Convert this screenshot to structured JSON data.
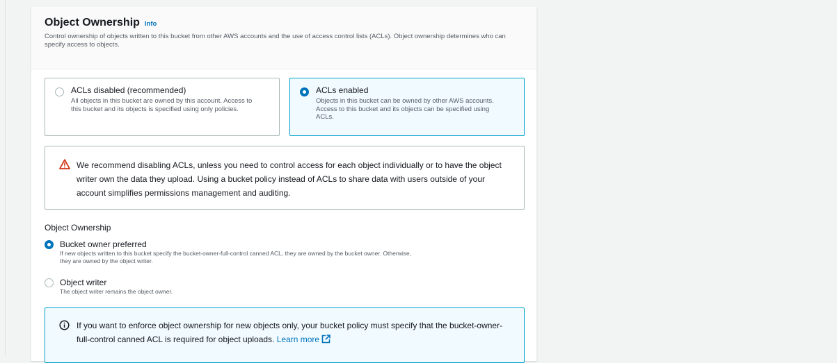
{
  "section": {
    "title": "Object Ownership",
    "info_label": "Info",
    "description": "Control ownership of objects written to this bucket from other AWS accounts and the use of access control lists (ACLs). Object ownership determines who can specify access to objects."
  },
  "acl_tiles": [
    {
      "label": "ACLs disabled (recommended)",
      "description": "All objects in this bucket are owned by this account. Access to this bucket and its objects is specified using only policies.",
      "selected": false
    },
    {
      "label": "ACLs enabled",
      "description": "Objects in this bucket can be owned by other AWS accounts. Access to this bucket and its objects can be specified using ACLs.",
      "selected": true
    }
  ],
  "warning": {
    "icon": "warning-triangle-icon",
    "text": "We recommend disabling ACLs, unless you need to control access for each object individually or to have the object writer own the data they upload. Using a bucket policy instead of ACLs to share data with users outside of your account simplifies permissions management and auditing."
  },
  "ownership": {
    "group_label": "Object Ownership",
    "options": [
      {
        "label": "Bucket owner preferred",
        "description": "If new objects written to this bucket specify the bucket-owner-full-control canned ACL, they are owned by the bucket owner. Otherwise, they are owned by the object writer.",
        "selected": true
      },
      {
        "label": "Object writer",
        "description": "The object writer remains the object owner.",
        "selected": false
      }
    ]
  },
  "info_alert": {
    "icon": "info-circle-icon",
    "text": "If you want to enforce object ownership for new objects only, your bucket policy must specify that the bucket-owner-full-control canned ACL is required for object uploads.",
    "link_label": "Learn more",
    "link_icon": "external-link-icon"
  },
  "colors": {
    "accent": "#0073bb",
    "selected_border": "#00a1c9",
    "selected_bg": "#f1faff",
    "warning": "#d13212"
  }
}
